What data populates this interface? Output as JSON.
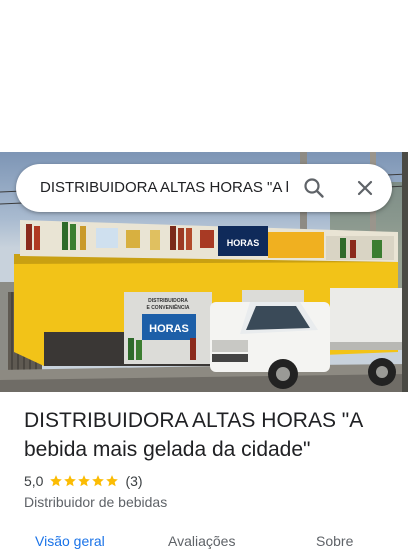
{
  "search": {
    "query": "DISTRIBUIDORA ALTAS HORAS \"A bebida mais gelada da cidade\""
  },
  "photo": {
    "sign_left_line1": "DISTRIBUIDORA",
    "sign_left_line2": "E CONVENIÊNCIA",
    "sign_logo": "HORAS",
    "shutter_line1": "DISTRIBUIDORA",
    "shutter_line2": "E CONVENIÊNCIA",
    "shutter_logo": "HORAS"
  },
  "place": {
    "title": "DISTRIBUIDORA ALTAS HORAS \"A bebida mais gelada da cidade\"",
    "rating": "5,0",
    "stars": 5,
    "review_count": "(3)",
    "category": "Distribuidor de bebidas"
  },
  "tabs": [
    {
      "label": "Visão geral"
    },
    {
      "label": "Avaliações"
    },
    {
      "label": "Sobre"
    }
  ],
  "colors": {
    "accent": "#1a73e8",
    "star": "#fbbc04",
    "wall_yellow": "#f2c318"
  }
}
